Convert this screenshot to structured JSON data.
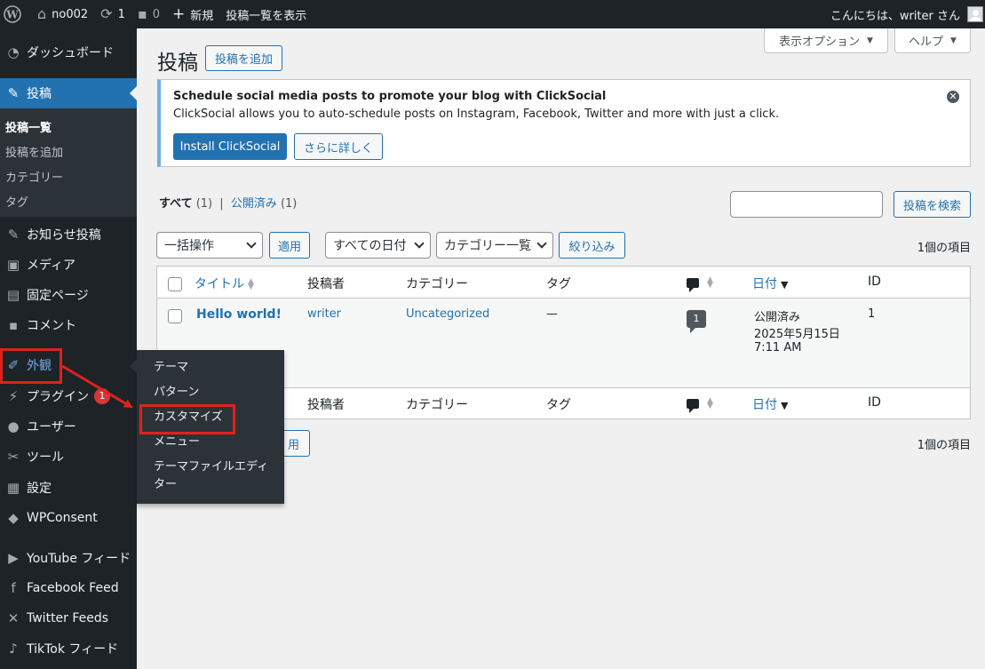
{
  "admin_bar": {
    "site_name": "no002",
    "updates_count": "1",
    "comments_count": "0",
    "new_label": "新規",
    "view_posts_label": "投稿一覧を表示",
    "greeting": "こんにちは、writer さん"
  },
  "sidebar": {
    "dashboard": "ダッシュボード",
    "posts": "投稿",
    "posts_submenu": [
      "投稿一覧",
      "投稿を追加",
      "カテゴリー",
      "タグ"
    ],
    "news_posts": "お知らせ投稿",
    "media": "メディア",
    "pages": "固定ページ",
    "comments": "コメント",
    "appearance": "外観",
    "plugins": "プラグイン",
    "plugins_badge": "1",
    "users": "ユーザー",
    "tools": "ツール",
    "settings": "設定",
    "wpconsent": "WPConsent",
    "youtube": "YouTube フィード",
    "facebook": "Facebook Feed",
    "twitter": "Twitter Feeds",
    "tiktok": "TikTok フィード"
  },
  "flyout": {
    "items": [
      "テーマ",
      "パターン",
      "カスタマイズ",
      "メニュー",
      "テーマファイルエディ",
      "ター"
    ]
  },
  "header": {
    "screen_options": "表示オプション",
    "help": "ヘルプ",
    "page_title": "投稿",
    "add_new": "投稿を追加"
  },
  "notice": {
    "title": "Schedule social media posts to promote your blog with ClickSocial",
    "text": "ClickSocial allows you to auto-schedule posts on Instagram, Facebook, Twitter and more with just a click.",
    "install_btn": "Install ClickSocial",
    "learn_btn": "さらに詳しく"
  },
  "filters": {
    "all_label": "すべて",
    "all_count": "(1)",
    "separator": "|",
    "published_label": "公開済み",
    "published_count": "(1)",
    "search_button": "投稿を検索",
    "bulk_actions": "一括操作",
    "apply": "適用",
    "all_dates": "すべての日付",
    "category_list": "カテゴリー一覧",
    "filter_button": "絞り込み",
    "items_count": "1個の項目"
  },
  "table": {
    "columns": {
      "title": "タイトル",
      "author": "投稿者",
      "categories": "カテゴリー",
      "tags": "タグ",
      "date": "日付",
      "id": "ID"
    },
    "rows": [
      {
        "title": "Hello world!",
        "author": "writer",
        "category": "Uncategorized",
        "tags": "—",
        "comments": "1",
        "status": "公開済み",
        "date": "2025年5月15日",
        "time": "7:11 AM",
        "id": "1"
      }
    ]
  },
  "bottom": {
    "apply_partial": "用",
    "items_count": "1個の項目"
  },
  "colors": {
    "admin_dark": "#1d2327",
    "accent": "#2271b1",
    "annotation_red": "#e0221b"
  }
}
